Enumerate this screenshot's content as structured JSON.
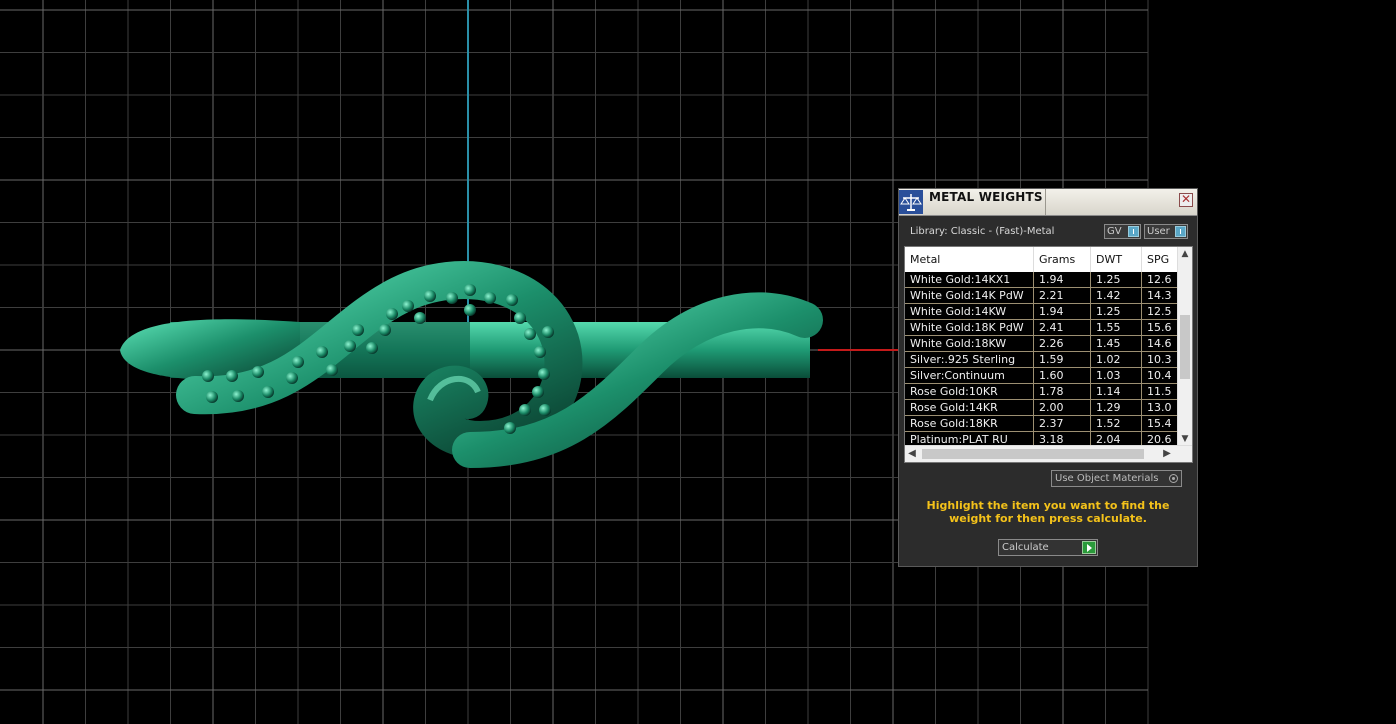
{
  "panel": {
    "title": "METAL WEIGHTS",
    "close_label": "✕",
    "library": "Library: Classic - (Fast)-Metal",
    "gv_label": "GV",
    "user_label": "User",
    "use_object_materials": "Use Object Materials",
    "hint": "Highlight the item you want to find the weight for then press calculate.",
    "calculate_label": "Calculate"
  },
  "table": {
    "headers": [
      "Metal",
      "Grams",
      "DWT",
      "SPG"
    ],
    "rows": [
      [
        "White Gold:14KX1",
        "1.94",
        "1.25",
        "12.6"
      ],
      [
        "White Gold:14K PdW",
        "2.21",
        "1.42",
        "14.3"
      ],
      [
        "White Gold:14KW",
        "1.94",
        "1.25",
        "12.5"
      ],
      [
        "White Gold:18K PdW",
        "2.41",
        "1.55",
        "15.6"
      ],
      [
        "White Gold:18KW",
        "2.26",
        "1.45",
        "14.6"
      ],
      [
        "Silver:.925 Sterling",
        "1.59",
        "1.02",
        "10.3"
      ],
      [
        "Silver:Continuum",
        "1.60",
        "1.03",
        "10.4"
      ],
      [
        "Rose Gold:10KR",
        "1.78",
        "1.14",
        "11.5"
      ],
      [
        "Rose Gold:14KR",
        "2.00",
        "1.29",
        "13.0"
      ],
      [
        "Rose Gold:18KR",
        "2.37",
        "1.52",
        "15.4"
      ],
      [
        "Platinum:PLAT RU",
        "3.18",
        "2.04",
        "20.6"
      ]
    ]
  }
}
